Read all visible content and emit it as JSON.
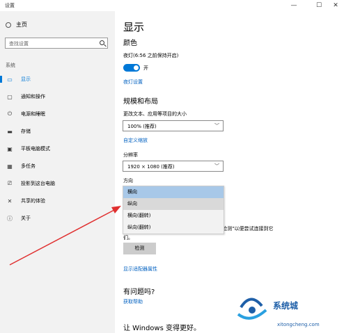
{
  "window": {
    "title": "设置",
    "controls": [
      "—",
      "☐",
      "✕"
    ]
  },
  "sidebar": {
    "home_label": "主页",
    "search_placeholder": "查找设置",
    "section": "系统",
    "items": [
      {
        "label": "显示",
        "icon": "monitor-icon",
        "glyph": "▭",
        "active": true
      },
      {
        "label": "通知和操作",
        "icon": "message-icon",
        "glyph": "▢",
        "active": false
      },
      {
        "label": "电源和睡眠",
        "icon": "power-icon",
        "glyph": "⏻",
        "active": false
      },
      {
        "label": "存储",
        "icon": "storage-icon",
        "glyph": "▬",
        "active": false
      },
      {
        "label": "平板电脑模式",
        "icon": "tablet-icon",
        "glyph": "▣",
        "active": false
      },
      {
        "label": "多任务",
        "icon": "multitask-icon",
        "glyph": "▦",
        "active": false
      },
      {
        "label": "投影到这台电脑",
        "icon": "project-icon",
        "glyph": "⎚",
        "active": false
      },
      {
        "label": "共享的体验",
        "icon": "share-icon",
        "glyph": "✕",
        "active": false
      },
      {
        "label": "关于",
        "icon": "info-icon",
        "glyph": "ⓘ",
        "active": false
      }
    ]
  },
  "main": {
    "title": "显示",
    "color_heading": "颜色",
    "night_light_label": "夜灯(6:56 之前保持开启)",
    "toggle_state": "开",
    "night_light_link": "夜灯设置",
    "scale_heading": "规模和布局",
    "scale_label": "更改文本、应用等项目的大小",
    "scale_value": "100% (推荐)",
    "custom_scale_link": "自定义缩放",
    "resolution_label": "分辨率",
    "resolution_value": "1920 × 1080 (推荐)",
    "orientation_label": "方向",
    "orientation_options": [
      "横向",
      "纵向",
      "横向(翻转)",
      "纵向(翻转)"
    ],
    "detect_text": "\"检测\"以便尝试连接到它",
    "detect_text2": "们。",
    "detect_button": "检测",
    "adapter_link": "显示适配器属性",
    "question_heading": "有问题吗?",
    "help_link": "获取帮助",
    "improve_heading": "让 Windows 变得更好。"
  },
  "colors": {
    "accent": "#0078d7",
    "arrow": "#e03030",
    "selected": "#a8c8e8"
  },
  "watermark": {
    "name": "系统城",
    "url": "xitongcheng.com"
  }
}
